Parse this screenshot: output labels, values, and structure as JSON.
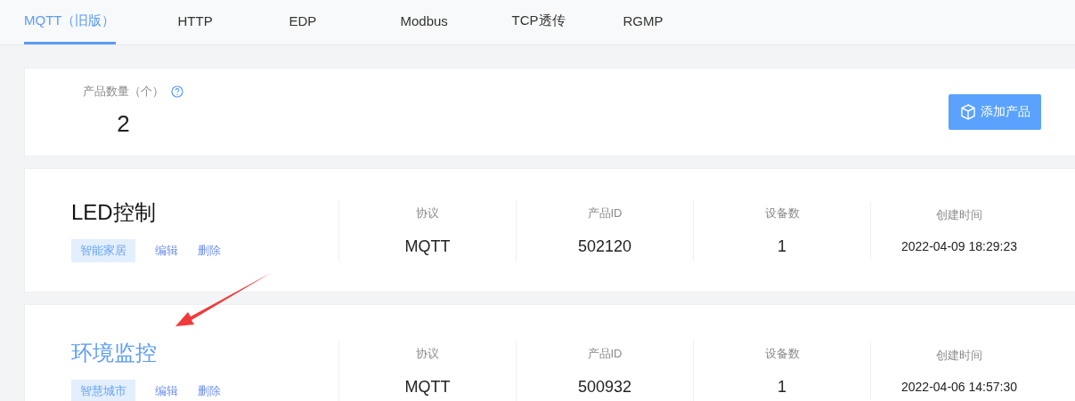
{
  "tabs": [
    {
      "label": "MQTT（旧版）",
      "selected": true
    },
    {
      "label": "HTTP",
      "selected": false
    },
    {
      "label": "EDP",
      "selected": false
    },
    {
      "label": "Modbus",
      "selected": false
    },
    {
      "label": "TCP透传",
      "selected": false
    },
    {
      "label": "RGMP",
      "selected": false
    }
  ],
  "summary": {
    "label": "产品数量（个）",
    "count": "2",
    "add_button": "添加产品"
  },
  "products": [
    {
      "name": "LED控制",
      "highlighted": false,
      "tag": "智能家居",
      "actions": [
        "编辑",
        "删除"
      ],
      "fields": [
        {
          "label": "协议",
          "value": "MQTT"
        },
        {
          "label": "产品ID",
          "value": "502120"
        },
        {
          "label": "设备数",
          "value": "1"
        },
        {
          "label": "创建时间",
          "value": "2022-04-09 18:29:23"
        }
      ]
    },
    {
      "name": "环境监控",
      "highlighted": true,
      "tag": "智慧城市",
      "actions": [
        "编辑",
        "删除"
      ],
      "fields": [
        {
          "label": "协议",
          "value": "MQTT"
        },
        {
          "label": "产品ID",
          "value": "500932"
        },
        {
          "label": "设备数",
          "value": "1"
        },
        {
          "label": "创建时间",
          "value": "2022-04-06 14:57:30"
        }
      ]
    }
  ]
}
